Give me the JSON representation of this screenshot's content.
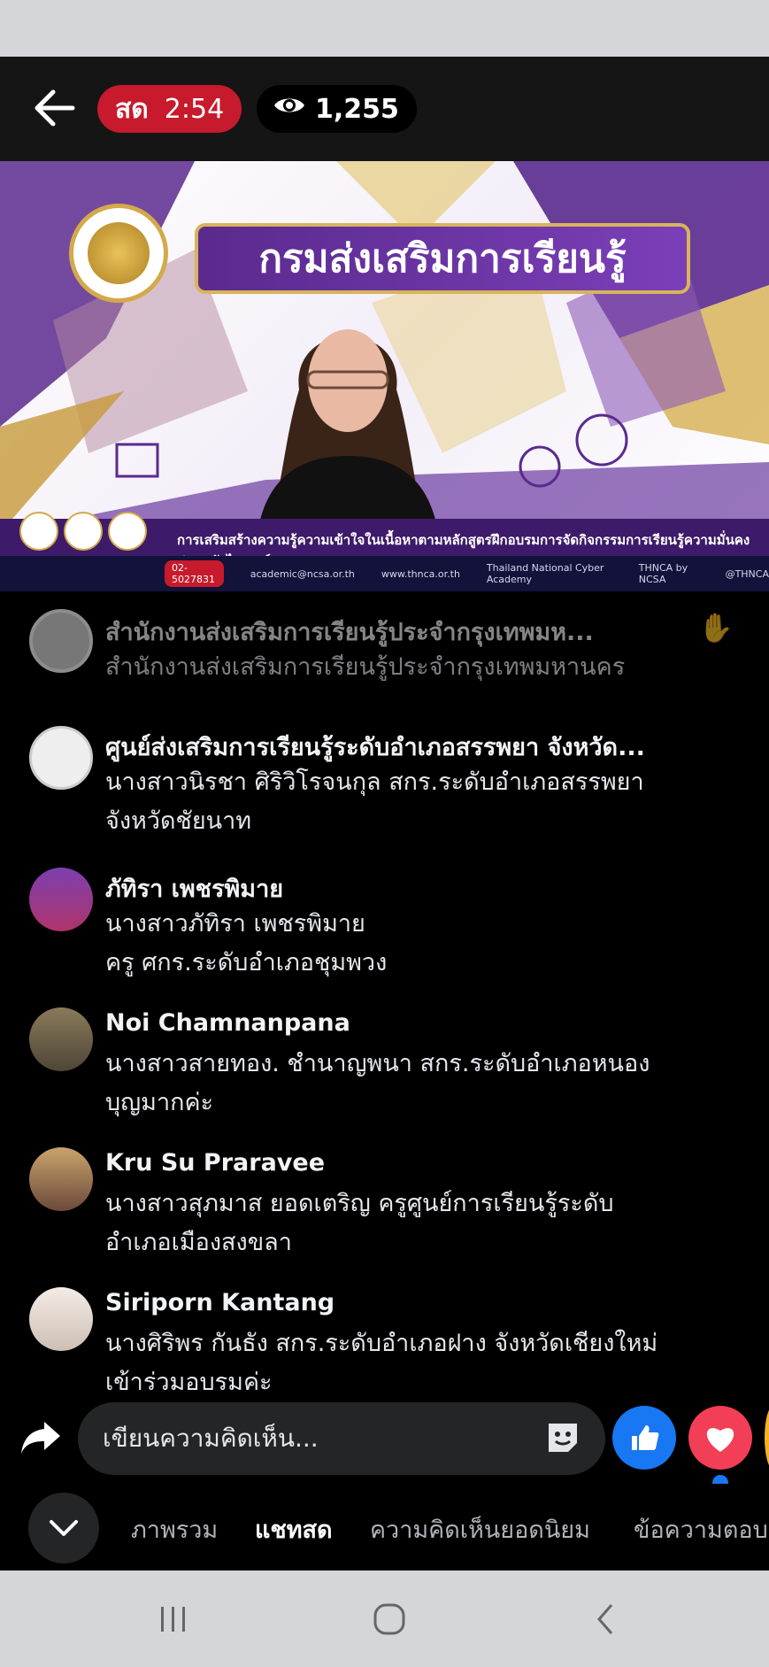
{
  "header": {
    "live_label": "สด",
    "live_time": "2:54",
    "viewer_count": "1,255"
  },
  "video": {
    "banner_title": "กรมส่งเสริมการเรียนรู้",
    "strip_caption": "การเสริมสร้างความรู้ความเข้าใจในเนื้อหาตามหลักสูตรฝึกอบรมการจัดกิจกรรมการเรียนรู้ความมั่นคงปลอดภัยไซเบอร์",
    "contact_phone": "02-5027831",
    "contact_email": "academic@ncsa.or.th",
    "contact_web": "www.thnca.or.th",
    "contact_social": "Thailand National Cyber Academy",
    "contact_tiktok": "THNCA by NCSA",
    "contact_handle": "@THNCA"
  },
  "comments": [
    {
      "name": "สำนักงานส่งเสริมการเรียนรู้ประจำกรุงเทพมห...",
      "lines": [
        "สำนักงานส่งเสริมการเรียนรู้ประจำกรุงเทพมหานคร"
      ]
    },
    {
      "name": "ศูนย์ส่งเสริมการเรียนรู้ระดับอำเภอสรรพยา จังหวัด...",
      "lines": [
        "นางสาวนิรชา  ศิริวิโรจนกุล  สกร.ระดับอำเภอสรรพยา",
        "จังหวัดชัยนาท"
      ]
    },
    {
      "name": "ภัทิรา เพชรพิมาย",
      "lines": [
        "นางสาวภัทิรา เพชรพิมาย",
        "ครู ศกร.ระดับอำเภอชุมพวง"
      ]
    },
    {
      "name": "Noi Chamnanpana",
      "lines": [
        "นางสาวสายทอง. ชำนาญพนา  สกร.ระดับอำเภอหนอง",
        "บุญมากค่ะ"
      ]
    },
    {
      "name": "Kru Su Praravee",
      "lines": [
        "นางสาวสุภมาส   ยอดเตริญ ครูศูนย์การเรียนรู้ระดับ",
        "อำเภอเมืองสงขลา"
      ]
    },
    {
      "name": "Siriporn Kantang",
      "lines": [
        "นางศิริพร  กันธัง  สกร.ระดับอำเภอฝาง จังหวัดเชียงใหม่",
        "เข้าร่วมอบรมค่ะ"
      ]
    }
  ],
  "composer": {
    "placeholder": "เขียนความคิดเห็น..."
  },
  "tabs": [
    {
      "label": "ภาพรวม"
    },
    {
      "label": "แชทสด"
    },
    {
      "label": "ความคิดเห็นยอดนิยม"
    },
    {
      "label": "ข้อความตอบ"
    }
  ],
  "colors": {
    "live_red": "#c71a2c",
    "like_blue": "#1877f2",
    "love_red": "#f33e58",
    "banner_purple": "#5a2a8e",
    "gold": "#d4a94a"
  }
}
